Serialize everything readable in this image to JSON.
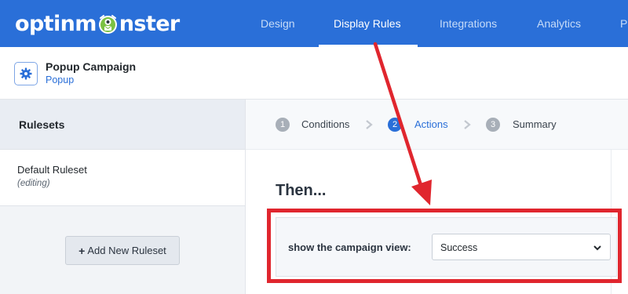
{
  "logo": {
    "text_before": "optinm",
    "text_after": "nster"
  },
  "nav": {
    "items": [
      {
        "label": "Design",
        "active": false
      },
      {
        "label": "Display Rules",
        "active": true
      },
      {
        "label": "Integrations",
        "active": false
      },
      {
        "label": "Analytics",
        "active": false
      },
      {
        "label": "P",
        "active": false
      }
    ]
  },
  "campaign": {
    "title": "Popup Campaign",
    "type": "Popup",
    "icon": "gear-icon"
  },
  "sidebar": {
    "heading": "Rulesets",
    "rulesets": [
      {
        "name": "Default Ruleset",
        "status": "(editing)"
      }
    ],
    "add_button_label": "Add New Ruleset"
  },
  "steps": [
    {
      "number": "1",
      "label": "Conditions",
      "active": false
    },
    {
      "number": "2",
      "label": "Actions",
      "active": true
    },
    {
      "number": "3",
      "label": "Summary",
      "active": false
    }
  ],
  "main": {
    "heading": "Then...",
    "action_label": "show the campaign view:",
    "view_select": {
      "selected": "Success"
    }
  },
  "colors": {
    "brand_blue": "#2a6fd8",
    "annotation_red": "#e0262e",
    "monster_green": "#7bc142"
  }
}
